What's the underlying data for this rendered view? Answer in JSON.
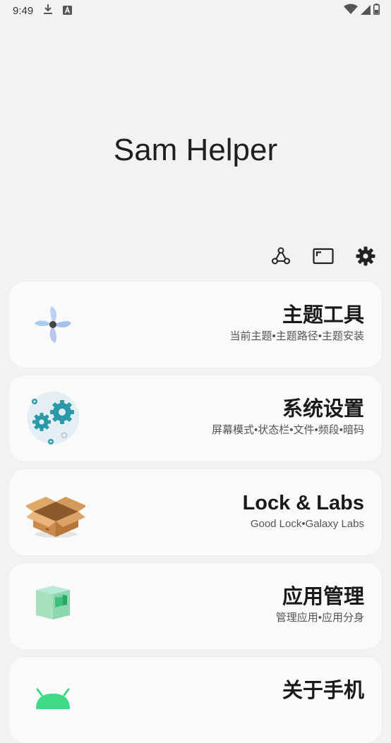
{
  "status_bar": {
    "time": "9:49",
    "left_icons": [
      "download-icon",
      "a-letter-icon"
    ],
    "right_icons": [
      "wifi-icon",
      "cellular-icon",
      "battery-icon"
    ]
  },
  "app": {
    "title": "Sam Helper"
  },
  "toolbar": {
    "icons": [
      "share-nodes-icon",
      "screen-frame-icon",
      "gear-icon"
    ]
  },
  "cards": [
    {
      "icon": "pinwheel-icon",
      "title": "主题工具",
      "subtitle": "当前主题•主题路径•主题安装"
    },
    {
      "icon": "gears-icon",
      "title": "系统设置",
      "subtitle": "屏幕模式•状态栏•文件•频段•暗码"
    },
    {
      "icon": "open-box-icon",
      "title": "Lock & Labs",
      "subtitle": "Good Lock•Galaxy Labs"
    },
    {
      "icon": "cube-icon",
      "title": "应用管理",
      "subtitle": "管理应用•应用分身"
    },
    {
      "icon": "android-icon",
      "title": "关于手机",
      "subtitle": ""
    }
  ],
  "colors": {
    "background": "#f2f2f2",
    "card": "#fafafa",
    "accent_teal": "#2a9aa8"
  }
}
